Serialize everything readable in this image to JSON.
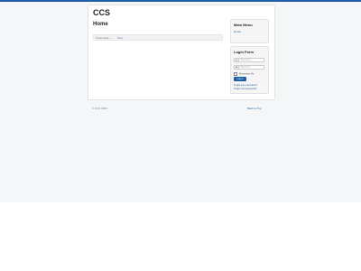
{
  "site": {
    "title": "CCS"
  },
  "page": {
    "title": "Home"
  },
  "breadcrumb": {
    "here": "You are here:",
    "sep": "»",
    "current": "Home"
  },
  "main_menu": {
    "title": "Main Menu",
    "items": [
      {
        "label": "Home"
      }
    ]
  },
  "login": {
    "title": "Login Form",
    "username_placeholder": "Username",
    "password_placeholder": "Password",
    "remember_label": "Remember Me",
    "button_label": "Log in",
    "forgot_username": "Forgot your username?",
    "forgot_password": "Forgot your password?"
  },
  "footer": {
    "copyright": "© CCS 2024",
    "back_to_top": "Back to Top"
  },
  "colors": {
    "accent": "#1e5fa6",
    "background": "#f4f6f7"
  },
  "icons": {
    "user": "user-icon",
    "lock": "lock-icon"
  }
}
